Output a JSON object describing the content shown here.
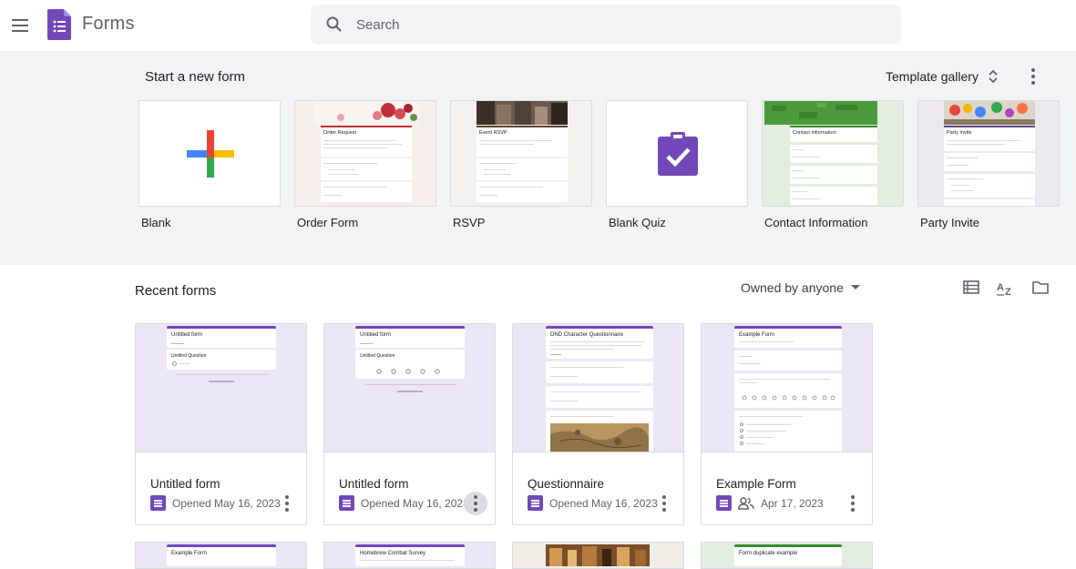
{
  "header": {
    "app_title": "Forms",
    "search_placeholder": "Search"
  },
  "new_form": {
    "title": "Start a new form",
    "template_gallery_label": "Template gallery",
    "templates": [
      {
        "label": "Blank"
      },
      {
        "label": "Order Form",
        "heading": "Order Request"
      },
      {
        "label": "RSVP",
        "heading": "Event RSVP"
      },
      {
        "label": "Blank Quiz"
      },
      {
        "label": "Contact Information",
        "heading": "Contact information"
      },
      {
        "label": "Party Invite",
        "heading": "Party Invite"
      }
    ]
  },
  "recent": {
    "title": "Recent forms",
    "filter_label": "Owned by anyone",
    "cards": [
      {
        "name": "Untitled form",
        "meta": "Opened May 16, 2023",
        "preview_title": "Untitled form",
        "preview_q": "Untitled Question"
      },
      {
        "name": "Untitled form",
        "meta": "Opened May 16, 2023",
        "preview_title": "Untitled form",
        "preview_q": "Untitled Question"
      },
      {
        "name": "Questionnaire",
        "meta": "Opened May 16, 2023",
        "preview_title": "DND Character Questionnaire"
      },
      {
        "name": "Example Form",
        "meta": "Apr 17, 2023",
        "preview_title": "Example Form"
      }
    ],
    "bottom_cards": [
      {
        "preview_title": "Example Form"
      },
      {
        "preview_title": "Homebrew Combat Survey"
      },
      {
        "preview_title": ""
      },
      {
        "preview_title": "Form duplicate example"
      }
    ]
  },
  "colors": {
    "brand_purple": "#7248b9",
    "section_bg": "#f1f3f4",
    "preview_bg": "#ebe6f6"
  }
}
